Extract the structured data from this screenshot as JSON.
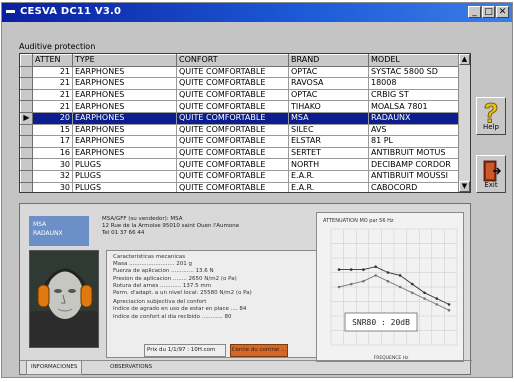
{
  "window": {
    "title": "CESVA DC11 V3.0"
  },
  "titlebar_buttons": [
    "_",
    "□",
    "✕"
  ],
  "list": {
    "group_label": "Auditive protection",
    "columns": [
      "ATTEN",
      "TYPE",
      "CONFORT",
      "BRAND",
      "MODEL"
    ],
    "rows": [
      [
        "21",
        "EARPHONES",
        "QUITE COMFORTABLE",
        "OPTAC",
        "SYSTAC 5800 SD"
      ],
      [
        "21",
        "EARPHONES",
        "QUITE COMFORTABLE",
        "RAVOSA",
        "18008"
      ],
      [
        "21",
        "EARPHONES",
        "QUITE COMFORTABLE",
        "OPTAC",
        "CRBIG ST"
      ],
      [
        "21",
        "EARPHONES",
        "QUITE COMFORTABLE",
        "TIHAKO",
        "MOALSA 7801"
      ],
      [
        "20",
        "EARPHONES",
        "QUITE COMFORTABLE",
        "MSA",
        "RADAUNX"
      ],
      [
        "15",
        "EARPHONES",
        "QUITE COMFORTABLE",
        "SILEC",
        "AVS"
      ],
      [
        "17",
        "EARPHONES",
        "QUITE COMFORTABLE",
        "ELSTAR",
        "81 PL"
      ],
      [
        "16",
        "EARPHONES",
        "QUITE COMFORTABLE",
        "SERTET",
        "ANTIBRUIT MOTUS"
      ],
      [
        "30",
        "PLUGS",
        "QUITE COMFORTABLE",
        "NORTH",
        "DECIBAMP CORDOR"
      ],
      [
        "32",
        "PLUGS",
        "QUITE COMFORTABLE",
        "E.A.R.",
        "ANTIBRUIT MOUSSI"
      ],
      [
        "30",
        "PLUGS",
        "QUITE COMFORTABLE",
        "E.A.R.",
        "CABOCORD"
      ]
    ],
    "selected_index": 4,
    "selected_marker": "▶"
  },
  "buttons": {
    "help": "Help",
    "exit": "Exit"
  },
  "detail": {
    "brand": "MSA",
    "model": "RADAUNX",
    "address_lines": [
      "MSA/GFF (su vendedor): MSA",
      "12 Rue de la Armoise 95010 saint Ouen l'Aumone",
      "Tel 01 37 66 44"
    ],
    "specs": {
      "heading": "Caracteristicas mecanicas",
      "lines": [
        "Masa .......................... 201 g",
        "Fuerza de aplicacion ............. 13.6 N",
        "Presion de aplicacion ........ 2650 N/m2 (o Pa)",
        "Rotura del arnes ............ 137.5 mm",
        "Perm. d'adapt. a un nivel local: 25580 N/m2 (o Pa)"
      ],
      "sub_heading": "Apreciacion subjectiva del confort",
      "sub_lines": [
        "Indice de agrado en uso de estar en place .... 84",
        "Indice de confort al dia recibido ............ 80"
      ]
    },
    "price_label": "Prix du 1/1/97 : 10H.com",
    "price_button": "Cercle du contrat ...",
    "chart": {
      "title": "ATTENUATION MO par 56 Hz",
      "snr_label": "SNR80 : 20dB",
      "xlabel": "FREQUENCE Hz",
      "series_a": [
        26,
        26,
        26,
        27,
        25,
        24,
        21,
        18,
        16,
        14
      ],
      "series_b": [
        20,
        21,
        22,
        24,
        22,
        20,
        18,
        16,
        14,
        12
      ]
    },
    "tabs": [
      "INFORMACIONES",
      "OBSERVATIONS"
    ]
  },
  "colors": {
    "titlebar_start": "#0a1fa0",
    "selection": "#0b1d8f",
    "brandbox": "#6b8fc6",
    "orange": "#d2692a",
    "help_icon": "#e7c20f",
    "exit_icon": "#9a2a0e"
  }
}
